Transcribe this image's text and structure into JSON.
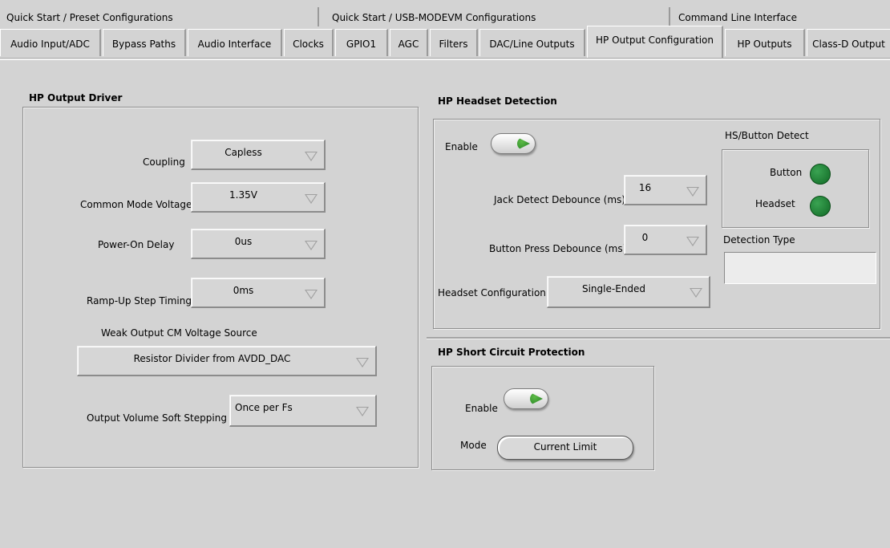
{
  "tabs_top": [
    "Quick Start / Preset Configurations",
    "Quick Start / USB-MODEVM Configurations",
    "Command Line Interface"
  ],
  "tabs": [
    "Audio Input/ADC",
    "Bypass Paths",
    "Audio Interface",
    "Clocks",
    "GPIO1",
    "AGC",
    "Filters",
    "DAC/Line Outputs",
    "HP Output Configuration",
    "HP Outputs",
    "Class-D Output"
  ],
  "active_tab": "HP Output Configuration",
  "hp_output_driver": {
    "title": "HP Output Driver",
    "coupling": {
      "label": "Coupling",
      "value": "Capless"
    },
    "common_mode": {
      "label": "Common Mode Voltage",
      "value": "1.35V"
    },
    "power_on_delay": {
      "label": "Power-On Delay",
      "value": "0us"
    },
    "ramp_up": {
      "label": "Ramp-Up Step Timing",
      "value": "0ms"
    },
    "weak_output": {
      "label": "Weak Output CM Voltage Source",
      "value": "Resistor Divider from AVDD_DAC"
    },
    "soft_stepping": {
      "label": "Output Volume Soft Stepping",
      "value": "Once per Fs"
    }
  },
  "hp_headset_detection": {
    "title": "HP Headset Detection",
    "enable_label": "Enable",
    "jack_debounce": {
      "label": "Jack Detect Debounce (ms)",
      "value": "16"
    },
    "button_debounce": {
      "label": "Button Press Debounce (ms)",
      "value": "0"
    },
    "headset_config": {
      "label": "Headset Configuration",
      "value": "Single-Ended"
    },
    "hs_button_detect": {
      "title": "HS/Button Detect",
      "button_label": "Button",
      "headset_label": "Headset"
    },
    "detection_type": {
      "label": "Detection Type",
      "value": ""
    }
  },
  "hp_short_circuit": {
    "title": "HP Short Circuit Protection",
    "enable_label": "Enable",
    "mode_label": "Mode",
    "mode_value": "Current Limit"
  },
  "colors": {
    "background": "#d3d3d3",
    "led_on": "#1f8a36"
  }
}
